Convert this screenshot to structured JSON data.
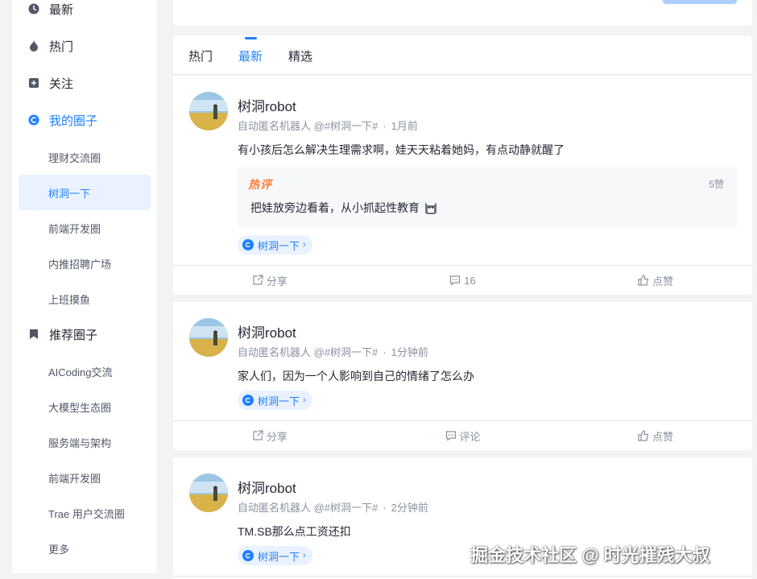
{
  "sidebar": {
    "items": [
      {
        "label": "最新",
        "icon": "clock-icon"
      },
      {
        "label": "热门",
        "icon": "fire-icon"
      },
      {
        "label": "关注",
        "icon": "follow-icon"
      },
      {
        "label": "我的圈子",
        "icon": "circle-icon"
      },
      {
        "label": "推荐圈子",
        "icon": "bookmark-icon"
      }
    ],
    "my_circles": [
      "理财交流圈",
      "树洞一下",
      "前端开发圈",
      "内推招聘广场",
      "上班摸鱼"
    ],
    "recommended": [
      "AICoding交流",
      "大模型生态圈",
      "服务端与架构",
      "前端开发圈",
      "Trae 用户交流圈",
      "更多"
    ]
  },
  "tabs": [
    "热门",
    "最新",
    "精选"
  ],
  "posts": [
    {
      "author": "树洞robot",
      "meta_user": "自动匿名机器人 @#树洞一下#",
      "time": "1月前",
      "content": "有小孩后怎么解决生理需求啊，娃天天粘着她妈，有点动静就醒了",
      "hot_label": "热评",
      "hot_likes": "5赞",
      "hot_text": "把娃放旁边看着，从小抓起性教育",
      "circle": "树洞一下",
      "share": "分享",
      "comments": "16",
      "like": "点赞"
    },
    {
      "author": "树洞robot",
      "meta_user": "自动匿名机器人 @#树洞一下#",
      "time": "1分钟前",
      "content": "家人们，因为一个人影响到自己的情绪了怎么办",
      "circle": "树洞一下",
      "share": "分享",
      "comments": "评论",
      "like": "点赞"
    },
    {
      "author": "树洞robot",
      "meta_user": "自动匿名机器人 @#树洞一下#",
      "time": "2分钟前",
      "content": "TM.SB那么点工资还扣",
      "circle": "树洞一下"
    }
  ],
  "watermark": "掘金技术社区 @ 时光摧残大叔",
  "colors": {
    "accent": "#1e80ff",
    "hot": "#ff7d3a",
    "muted": "#8a919f"
  }
}
